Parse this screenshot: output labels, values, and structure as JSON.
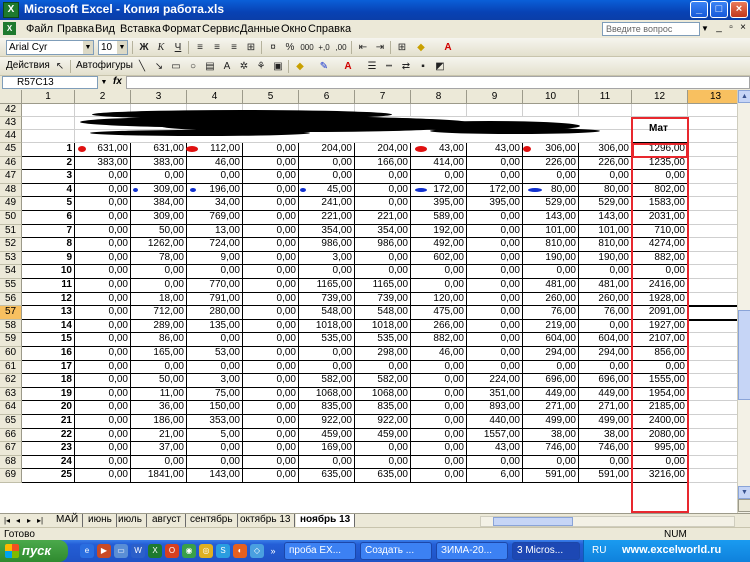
{
  "window": {
    "title": "Microsoft Excel - Копия работа.xls",
    "min": "_",
    "max": "□",
    "close": "×"
  },
  "menu": {
    "items": [
      "Файл",
      "Правка",
      "Вид",
      "Вставка",
      "Формат",
      "Сервис",
      "Данные",
      "Окно",
      "Справка"
    ],
    "help_placeholder": "Введите вопрос"
  },
  "format_toolbar": {
    "font": "Arial Cyr",
    "size": "10",
    "bold": "Ж",
    "italic": "К",
    "underline": "Ч",
    "percent": "%",
    "thousands": "000",
    "inc_dec": "+,0",
    "dec_dec": ",00"
  },
  "draw_toolbar": {
    "actions": "Действия",
    "autoshapes": "Автофигуры"
  },
  "formula_bar": {
    "namebox": "R57C13",
    "fx": "fx",
    "value": ""
  },
  "columns": [
    "1",
    "2",
    "3",
    "4",
    "5",
    "6",
    "7",
    "8",
    "9",
    "10",
    "11",
    "12",
    "13"
  ],
  "selected_column": "13",
  "selected_row": "57",
  "header_rows": [
    "42",
    "43",
    "44"
  ],
  "mat_label": "Мат",
  "rows": [
    {
      "r": "45",
      "k": "1",
      "v": [
        "631,00",
        "631,00",
        "112,00",
        "0,00",
        "204,00",
        "204,00",
        "43,00",
        "43,00",
        "306,00",
        "306,00",
        "1296,00"
      ]
    },
    {
      "r": "46",
      "k": "2",
      "v": [
        "383,00",
        "383,00",
        "46,00",
        "0,00",
        "0,00",
        "166,00",
        "414,00",
        "0,00",
        "226,00",
        "226,00",
        "1235,00"
      ]
    },
    {
      "r": "47",
      "k": "3",
      "v": [
        "0,00",
        "0,00",
        "0,00",
        "0,00",
        "0,00",
        "0,00",
        "0,00",
        "0,00",
        "0,00",
        "0,00",
        "0,00"
      ]
    },
    {
      "r": "48",
      "k": "4",
      "v": [
        "0,00",
        "309,00",
        "196,00",
        "0,00",
        "45,00",
        "0,00",
        "172,00",
        "172,00",
        "80,00",
        "80,00",
        "802,00"
      ]
    },
    {
      "r": "49",
      "k": "5",
      "v": [
        "0,00",
        "384,00",
        "34,00",
        "0,00",
        "241,00",
        "0,00",
        "395,00",
        "395,00",
        "529,00",
        "529,00",
        "1583,00"
      ]
    },
    {
      "r": "50",
      "k": "6",
      "v": [
        "0,00",
        "309,00",
        "769,00",
        "0,00",
        "221,00",
        "221,00",
        "589,00",
        "0,00",
        "143,00",
        "143,00",
        "2031,00"
      ]
    },
    {
      "r": "51",
      "k": "7",
      "v": [
        "0,00",
        "50,00",
        "13,00",
        "0,00",
        "354,00",
        "354,00",
        "192,00",
        "0,00",
        "101,00",
        "101,00",
        "710,00"
      ]
    },
    {
      "r": "52",
      "k": "8",
      "v": [
        "0,00",
        "1262,00",
        "724,00",
        "0,00",
        "986,00",
        "986,00",
        "492,00",
        "0,00",
        "810,00",
        "810,00",
        "4274,00"
      ]
    },
    {
      "r": "53",
      "k": "9",
      "v": [
        "0,00",
        "78,00",
        "9,00",
        "0,00",
        "3,00",
        "0,00",
        "602,00",
        "0,00",
        "190,00",
        "190,00",
        "882,00"
      ]
    },
    {
      "r": "54",
      "k": "10",
      "v": [
        "0,00",
        "0,00",
        "0,00",
        "0,00",
        "0,00",
        "0,00",
        "0,00",
        "0,00",
        "0,00",
        "0,00",
        "0,00"
      ]
    },
    {
      "r": "55",
      "k": "11",
      "v": [
        "0,00",
        "0,00",
        "770,00",
        "0,00",
        "1165,00",
        "1165,00",
        "0,00",
        "0,00",
        "481,00",
        "481,00",
        "2416,00"
      ]
    },
    {
      "r": "56",
      "k": "12",
      "v": [
        "0,00",
        "18,00",
        "791,00",
        "0,00",
        "739,00",
        "739,00",
        "120,00",
        "0,00",
        "260,00",
        "260,00",
        "1928,00"
      ]
    },
    {
      "r": "57",
      "k": "13",
      "v": [
        "0,00",
        "712,00",
        "280,00",
        "0,00",
        "548,00",
        "548,00",
        "475,00",
        "0,00",
        "76,00",
        "76,00",
        "2091,00"
      ]
    },
    {
      "r": "58",
      "k": "14",
      "v": [
        "0,00",
        "289,00",
        "135,00",
        "0,00",
        "1018,00",
        "1018,00",
        "266,00",
        "0,00",
        "219,00",
        "0,00",
        "1927,00"
      ]
    },
    {
      "r": "59",
      "k": "15",
      "v": [
        "0,00",
        "86,00",
        "0,00",
        "0,00",
        "535,00",
        "535,00",
        "882,00",
        "0,00",
        "604,00",
        "604,00",
        "2107,00"
      ]
    },
    {
      "r": "60",
      "k": "16",
      "v": [
        "0,00",
        "165,00",
        "53,00",
        "0,00",
        "0,00",
        "298,00",
        "46,00",
        "0,00",
        "294,00",
        "294,00",
        "856,00"
      ]
    },
    {
      "r": "61",
      "k": "17",
      "v": [
        "0,00",
        "0,00",
        "0,00",
        "0,00",
        "0,00",
        "0,00",
        "0,00",
        "0,00",
        "0,00",
        "0,00",
        "0,00"
      ]
    },
    {
      "r": "62",
      "k": "18",
      "v": [
        "0,00",
        "50,00",
        "3,00",
        "0,00",
        "582,00",
        "582,00",
        "0,00",
        "224,00",
        "696,00",
        "696,00",
        "1555,00"
      ]
    },
    {
      "r": "63",
      "k": "19",
      "v": [
        "0,00",
        "11,00",
        "75,00",
        "0,00",
        "1068,00",
        "1068,00",
        "0,00",
        "351,00",
        "449,00",
        "449,00",
        "1954,00"
      ]
    },
    {
      "r": "64",
      "k": "20",
      "v": [
        "0,00",
        "36,00",
        "150,00",
        "0,00",
        "835,00",
        "835,00",
        "0,00",
        "893,00",
        "271,00",
        "271,00",
        "2185,00"
      ]
    },
    {
      "r": "65",
      "k": "21",
      "v": [
        "0,00",
        "186,00",
        "353,00",
        "0,00",
        "922,00",
        "922,00",
        "0,00",
        "440,00",
        "499,00",
        "499,00",
        "2400,00"
      ]
    },
    {
      "r": "66",
      "k": "22",
      "v": [
        "0,00",
        "21,00",
        "5,00",
        "0,00",
        "459,00",
        "459,00",
        "0,00",
        "1557,00",
        "38,00",
        "38,00",
        "2080,00"
      ]
    },
    {
      "r": "67",
      "k": "23",
      "v": [
        "0,00",
        "37,00",
        "0,00",
        "0,00",
        "169,00",
        "0,00",
        "0,00",
        "43,00",
        "746,00",
        "746,00",
        "995,00"
      ]
    },
    {
      "r": "68",
      "k": "24",
      "v": [
        "0,00",
        "0,00",
        "0,00",
        "0,00",
        "0,00",
        "0,00",
        "0,00",
        "0,00",
        "0,00",
        "0,00",
        "0,00"
      ]
    },
    {
      "r": "69",
      "k": "25",
      "v": [
        "0,00",
        "1841,00",
        "143,00",
        "0,00",
        "635,00",
        "635,00",
        "0,00",
        "6,00",
        "591,00",
        "591,00",
        "3216,00"
      ]
    }
  ],
  "sheet_tabs": [
    "МАЙ",
    "июнь",
    "июль",
    "август",
    "сентябрь",
    "октябрь 13",
    "ноябрь 13"
  ],
  "active_tab": "ноябрь 13",
  "status": {
    "ready": "Готово",
    "num": "NUM"
  },
  "taskbar": {
    "start": "пуск",
    "buttons": [
      "проба EX...",
      "Создать ...",
      "ЗИМА-20...",
      "3 Micros..."
    ],
    "active_index": 3,
    "lang": "RU",
    "url": "www.excelworld.ru"
  },
  "colors": {
    "accent_red": "#e8282e",
    "mark_red": "#e01010",
    "mark_blue": "#1030d0",
    "selected_header": "#f8c060"
  }
}
